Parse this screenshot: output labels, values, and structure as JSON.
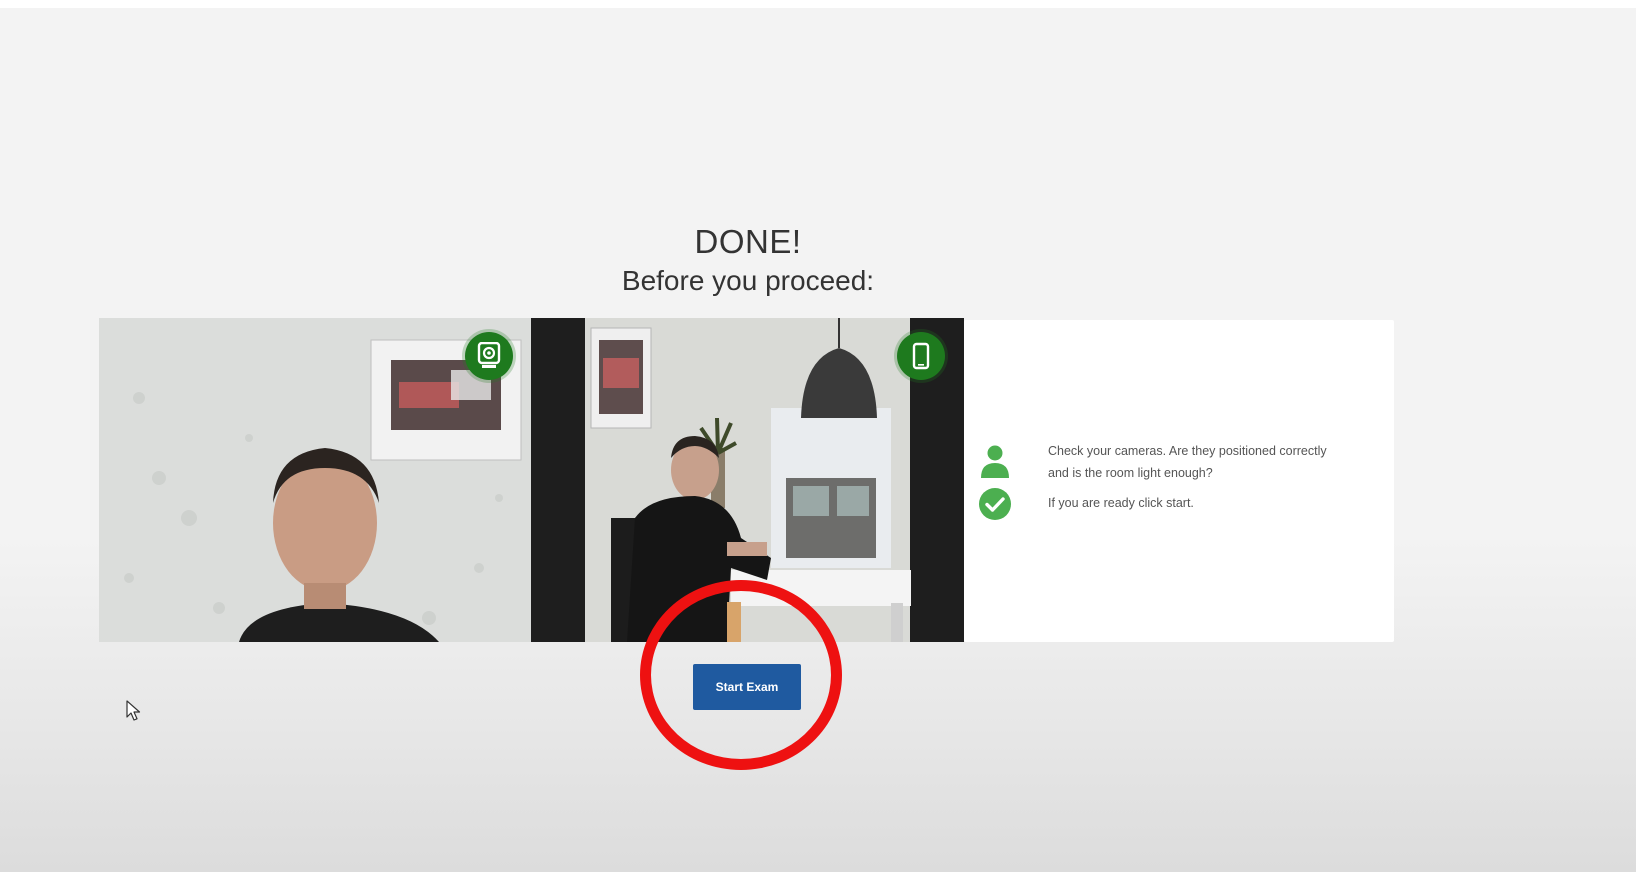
{
  "header": {
    "title": "DONE!",
    "subtitle": "Before you proceed:"
  },
  "cameras": {
    "webcam": {
      "icon": "webcam-icon"
    },
    "phone": {
      "icon": "smartphone-icon"
    }
  },
  "instructions": {
    "check_text": "Check your cameras. Are they positioned correctly and is the room light enough?",
    "ready_text": "If you are ready click start.",
    "icons": [
      "person-icon",
      "checkmark-circle-icon"
    ]
  },
  "actions": {
    "start_label": "Start Exam"
  },
  "colors": {
    "accent_green": "#1e7a1e",
    "panel_green": "#4caf50",
    "button_blue": "#1f5aa0",
    "highlight_red": "#ee1111"
  }
}
